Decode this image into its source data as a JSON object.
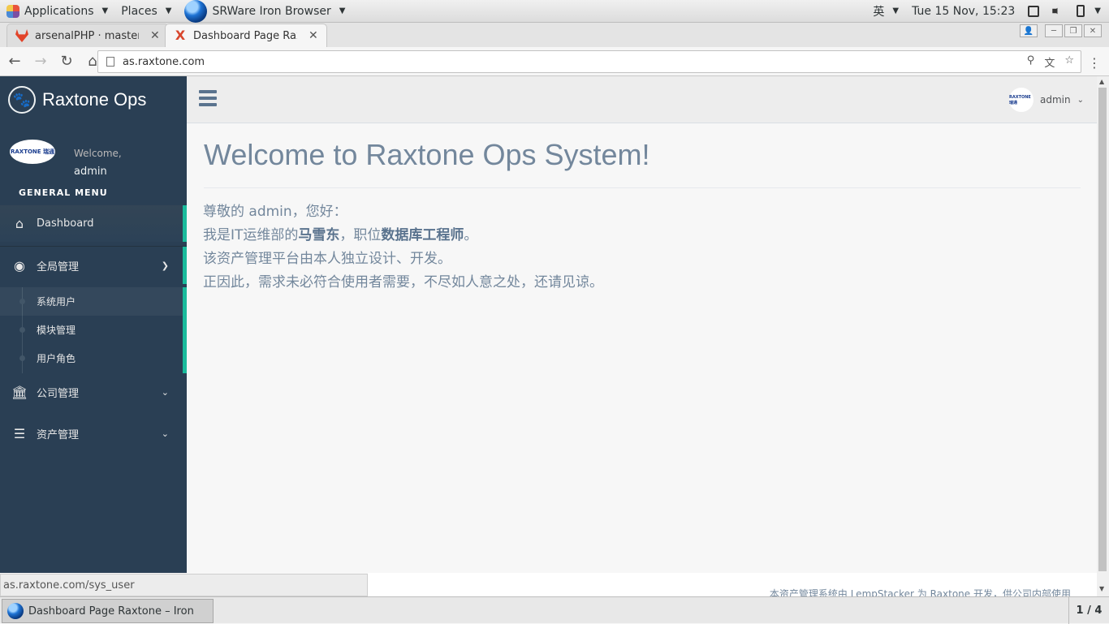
{
  "topbar": {
    "applications": "Applications",
    "places": "Places",
    "active_app": "SRWare Iron Browser",
    "input_method": "英",
    "clock": "Tue 15 Nov, 15:23"
  },
  "browser": {
    "tabs": [
      {
        "label": "arsenalPHP · master"
      },
      {
        "label": "Dashboard Page Raxtone"
      }
    ],
    "url": "as.raxtone.com",
    "status_url": "as.raxtone.com/sys_user"
  },
  "sidebar": {
    "brand": "Raxtone Ops",
    "avatar_text": "RAXTONE 瑞通",
    "welcome": "Welcome,",
    "username": "admin",
    "menu_heading": "GENERAL MENU",
    "items": [
      {
        "label": "Dashboard",
        "icon": "home-icon"
      },
      {
        "label": "全局管理",
        "icon": "globe-icon"
      },
      {
        "label": "公司管理",
        "icon": "bank-icon"
      },
      {
        "label": "资产管理",
        "icon": "list-icon"
      }
    ],
    "children": [
      "系统用户",
      "模块管理",
      "用户角色"
    ]
  },
  "topnav": {
    "user": "admin",
    "avatar_text": "RAXTONE 瑞通"
  },
  "main": {
    "title": "Welcome to Raxtone Ops System!",
    "line1": "尊敬的 admin，您好：",
    "line2_pre": "我是IT运维部的",
    "line2_name": "马雪东",
    "line2_mid": "，职位",
    "line2_role": "数据库工程师",
    "line2_post": "。",
    "line3": "该资产管理平台由本人独立设计、开发。",
    "line4": "正因此，需求未必符合使用者需要，不尽如人意之处，还请见谅。"
  },
  "footer": {
    "text": "本资产管理系统由 LempStacker 为 Raxtone 开发，供公司内部使用"
  },
  "taskbar": {
    "window_title": "Dashboard Page Raxtone – Iron",
    "workspace": "1 / 4"
  },
  "colors": {
    "sidebar": "#2a3f54",
    "accent": "#1ABB9C",
    "text_main": "#73879C"
  }
}
